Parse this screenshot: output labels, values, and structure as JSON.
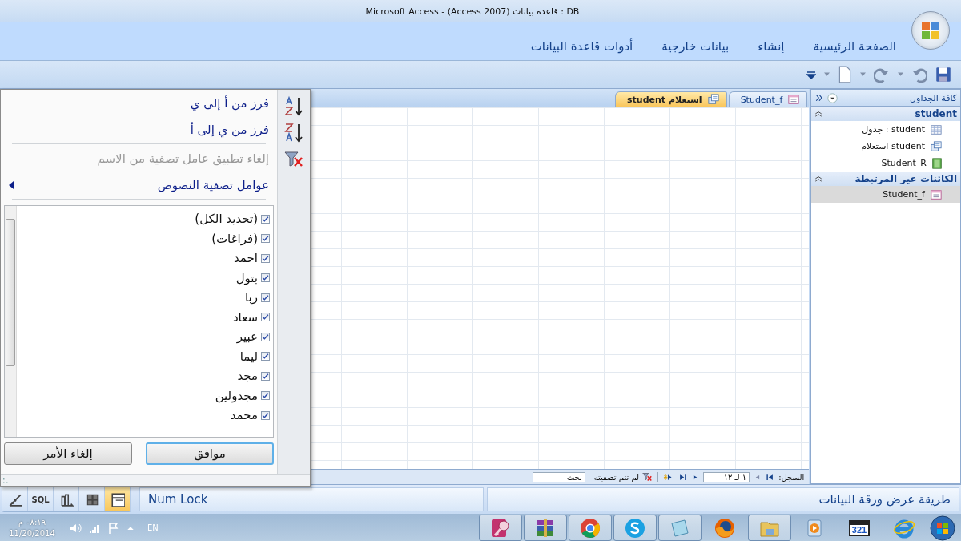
{
  "window": {
    "title": "Microsoft Access - (Access 2007) قاعدة بيانات : DB"
  },
  "ribbon_tabs": [
    {
      "label": "الصفحة الرئيسية"
    },
    {
      "label": "إنشاء"
    },
    {
      "label": "بيانات خارجية"
    },
    {
      "label": "أدوات قاعدة البيانات"
    }
  ],
  "document_tabs": [
    {
      "label": "Student_f",
      "kind": "form",
      "selected": false
    },
    {
      "label": "student استعلام",
      "kind": "query",
      "selected": true
    }
  ],
  "filter_menu": {
    "commands": [
      {
        "kind": "sort-asc",
        "label": "فرز من أ إلى ي",
        "disabled": false
      },
      {
        "kind": "sort-desc",
        "label": "فرز من ي إلى أ",
        "disabled": false
      },
      {
        "kind": "clear-filter",
        "label": "إلغاء تطبيق عامل تصفية من الاسم",
        "disabled": true
      },
      {
        "kind": "submenu",
        "label": "عوامل تصفية النصوص",
        "disabled": false
      }
    ],
    "values": [
      {
        "label": "(تحديد الكل)",
        "checked": true
      },
      {
        "label": "(فراغات)",
        "checked": true
      },
      {
        "label": "احمد",
        "checked": true
      },
      {
        "label": "بتول",
        "checked": true
      },
      {
        "label": "ربا",
        "checked": true
      },
      {
        "label": "سعاد",
        "checked": true
      },
      {
        "label": "عبير",
        "checked": true
      },
      {
        "label": "ليما",
        "checked": true
      },
      {
        "label": "مجد",
        "checked": true
      },
      {
        "label": "مجدولين",
        "checked": true
      },
      {
        "label": "محمد",
        "checked": true
      }
    ],
    "buttons": [
      {
        "label": "موافق",
        "focused": true
      },
      {
        "label": "إلغاء الأمر",
        "focused": false
      }
    ]
  },
  "navigation_pane": {
    "title": "كافة الجداول",
    "groups": [
      {
        "title": "student",
        "expanded": true,
        "items": [
          {
            "label": "student : جدول",
            "kind": "table",
            "selected": false
          },
          {
            "label": "student استعلام",
            "kind": "query",
            "selected": false
          },
          {
            "label": "Student_R",
            "kind": "report",
            "selected": false
          }
        ]
      },
      {
        "title": "الكائنات غير المرتبطة",
        "expanded": true,
        "items": [
          {
            "label": "Student_f",
            "kind": "form",
            "selected": true
          }
        ]
      }
    ]
  },
  "record_navigator": {
    "label": "السجل:",
    "position": "١ لـ ١٢",
    "filter_status": "لم تتم تصفيته",
    "search_placeholder": "بحث"
  },
  "status_bar": {
    "text": "طريقة عرض ورقة البيانات",
    "indicator": "Num Lock",
    "views": [
      {
        "kind": "design",
        "selected": false
      },
      {
        "kind": "sql",
        "label": "SQL",
        "selected": false
      },
      {
        "kind": "pivot-chart",
        "selected": false
      },
      {
        "kind": "pivot-table",
        "selected": false
      },
      {
        "kind": "datasheet",
        "selected": true
      }
    ]
  },
  "taskbar": {
    "time": "٠٨:١٩ م",
    "date": "11/20/2014",
    "language": "EN",
    "apps": [
      {
        "kind": "access",
        "running": true
      },
      {
        "kind": "archiver",
        "running": true
      },
      {
        "kind": "chrome",
        "running": true
      },
      {
        "kind": "skype",
        "running": true
      },
      {
        "kind": "notepad",
        "running": true
      },
      {
        "kind": "firefox",
        "running": false
      },
      {
        "kind": "folder",
        "running": true
      },
      {
        "kind": "media",
        "running": false
      },
      {
        "kind": "player",
        "label": "321",
        "running": false
      },
      {
        "kind": "ie",
        "running": false
      }
    ]
  }
}
